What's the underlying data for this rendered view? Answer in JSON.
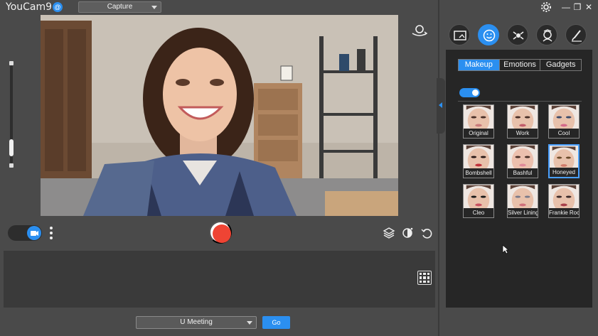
{
  "app": {
    "title": "YouCam9",
    "badge": "@"
  },
  "header": {
    "mode_selected": "Capture"
  },
  "icons": {
    "avatar_switch": "avatar-switch-icon",
    "more": "more-vertical-icon",
    "layers": "layers-icon",
    "brightness": "brightness-icon",
    "undo": "undo-icon",
    "grid": "grid-icon",
    "settings": "gear-icon"
  },
  "window_controls": {
    "minimize": "—",
    "restore": "❐",
    "close": "✕"
  },
  "effect_tabs": [
    {
      "name": "scene",
      "active": false
    },
    {
      "name": "face-effects",
      "active": true
    },
    {
      "name": "particles",
      "active": false
    },
    {
      "name": "avatar",
      "active": false
    },
    {
      "name": "brush",
      "active": false
    }
  ],
  "effects_panel": {
    "sub_tabs": [
      {
        "label": "Makeup",
        "active": true
      },
      {
        "label": "Emotions",
        "active": false
      },
      {
        "label": "Gadgets",
        "active": false
      }
    ],
    "makeup_enabled": true,
    "presets": [
      {
        "label": "Original",
        "selected": false
      },
      {
        "label": "Work",
        "selected": false
      },
      {
        "label": "Cool",
        "selected": false
      },
      {
        "label": "Bombshell",
        "selected": false
      },
      {
        "label": "Bashful",
        "selected": false
      },
      {
        "label": "Honeyed",
        "selected": true
      },
      {
        "label": "Cleo",
        "selected": false
      },
      {
        "label": "Silver Lining",
        "selected": false
      },
      {
        "label": "Frankie Roc",
        "selected": false
      }
    ]
  },
  "footer": {
    "meeting_selected": "U Meeting",
    "go_label": "Go"
  },
  "colors": {
    "accent": "#2b8ff0",
    "record": "#ef4434",
    "panel_bg": "#262626",
    "app_bg": "#4a4a4a"
  }
}
